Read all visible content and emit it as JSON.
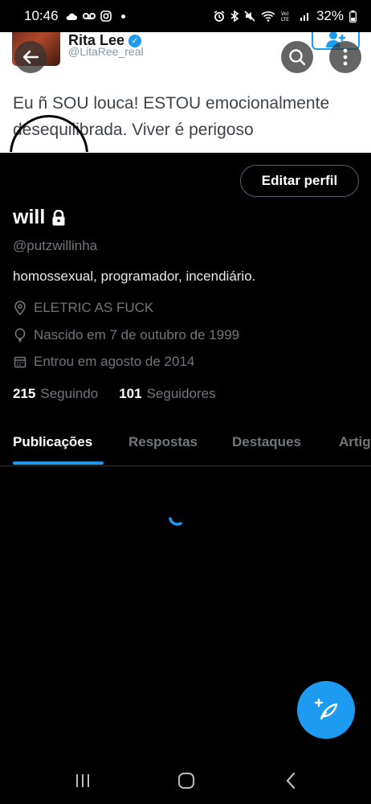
{
  "status_bar": {
    "time": "10:46",
    "battery": "32%",
    "icons_left": [
      "cloud-icon",
      "voicemail-icon",
      "instagram-icon"
    ],
    "icons_right": [
      "alarm-icon",
      "bluetooth-icon",
      "mute-icon",
      "wifi-icon",
      "volte-icon",
      "signal-icon",
      "battery-icon"
    ],
    "volte_label": "Vo)\nLTE"
  },
  "banner": {
    "author_name": "Rita Lee",
    "author_handle": "@LitaRee_real",
    "tweet_text": "Eu ñ SOU louca! ESTOU emocionalmente desequilibrada. Viver é perigoso"
  },
  "profile": {
    "edit_button": "Editar perfil",
    "display_name": "will",
    "handle": "@putzwillinha",
    "bio": "homossexual, programador, incendiário.",
    "location": "ELETRIC AS FUCK",
    "birth": "Nascido em 7 de outubro de 1999",
    "joined": "Entrou em agosto de 2014",
    "following_count": "215",
    "following_label": "Seguindo",
    "followers_count": "101",
    "followers_label": "Seguidores"
  },
  "tabs": [
    "Publicações",
    "Respostas",
    "Destaques",
    "Artigos"
  ],
  "colors": {
    "accent": "#1d9bf0",
    "background": "#000000",
    "muted_text": "#71767b"
  }
}
